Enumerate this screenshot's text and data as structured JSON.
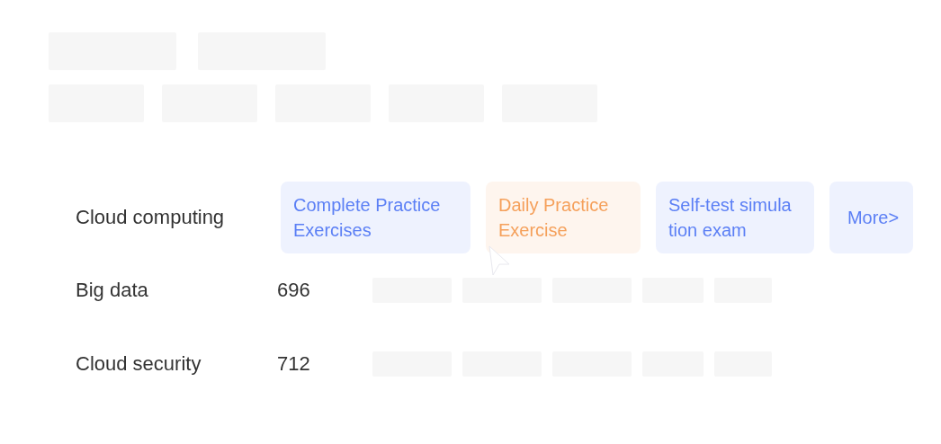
{
  "rows": [
    {
      "label": "Cloud computing",
      "actions": [
        {
          "label": "Complete Practice Exercises",
          "color": "#5b7ff5"
        },
        {
          "label": "Daily Practice Exercise",
          "color": "#f5a05b"
        },
        {
          "label": "Self-test simula tion exam",
          "color": "#5b7ff5"
        },
        {
          "label": "More>",
          "color": "#5b7ff5"
        }
      ]
    },
    {
      "label": "Big data",
      "count": "696"
    },
    {
      "label": "Cloud security",
      "count": "712"
    }
  ]
}
